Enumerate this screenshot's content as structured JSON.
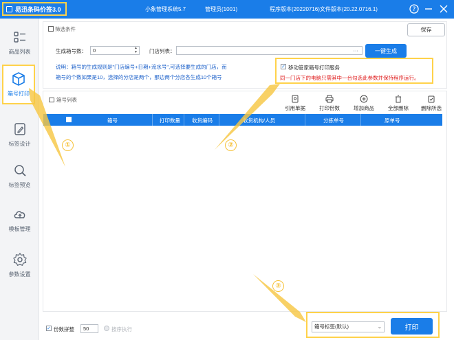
{
  "app": {
    "title": "易迅条码价签3.0",
    "center_title": "小象管理系统5.7",
    "admin": "管理员(1001)",
    "version": "程序版本(20220716)文件版本(20.22.0716.1)"
  },
  "sidebar": {
    "items": [
      {
        "label": "商品列表",
        "icon": "list-icon"
      },
      {
        "label": "箱号打印",
        "icon": "box-icon"
      },
      {
        "label": "标签设计",
        "icon": "pencil-icon"
      },
      {
        "label": "标签预览",
        "icon": "magnifier-icon"
      },
      {
        "label": "模板管理",
        "icon": "cloud-icon"
      },
      {
        "label": "参数设置",
        "icon": "gear-icon"
      }
    ]
  },
  "filter": {
    "title": "筛选条件",
    "save_label": "保存",
    "box_count_label": "生成箱号数：",
    "box_count_value": "0",
    "store_label": "门店列表：",
    "store_dots": "···",
    "generate_label": "一键生成",
    "desc_line1": "说明：箱号的生成规则是\"门店编号+日期+流水号\",可选择要生成的门店，而",
    "desc_line2": "箱号的个数如果是10，选择的分店是两个，那边两个分店各生成10个箱号",
    "service_checkbox": "移动管家箱号打印服务",
    "service_checked": true,
    "service_note": "同一门店下的电脑只需其中一台勾选此参数并保持程序运行。"
  },
  "list": {
    "title": "箱号列表",
    "toolbar": [
      {
        "label": "引用单据",
        "icon": "document-icon"
      },
      {
        "label": "打印份数",
        "icon": "printer-icon"
      },
      {
        "label": "增加商品",
        "icon": "plus-circle-icon"
      },
      {
        "label": "全部删除",
        "icon": "trash-icon"
      },
      {
        "label": "删除所选",
        "icon": "clipboard-check-icon"
      }
    ],
    "columns": [
      "箱号",
      "打印数量",
      "收货编码",
      "收货机构/人员",
      "分拣单号",
      "原单号"
    ],
    "rows": []
  },
  "bottom": {
    "copies_label": "份数拼整",
    "copies_checked": true,
    "copies_value": "50",
    "order_label": "按序执行",
    "template_select": "箱号标签(默认)",
    "print_label": "打印"
  },
  "annotations": [
    "①",
    "②",
    "③"
  ],
  "colors": {
    "accent": "#1a7de8",
    "highlight": "#ffd24a",
    "warning": "#e02020"
  }
}
